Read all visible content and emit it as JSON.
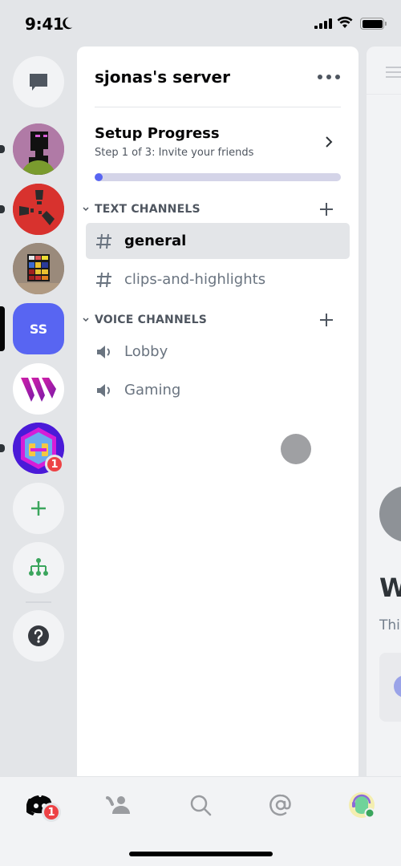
{
  "status_bar": {
    "time": "9:41",
    "focus_icon": "moon-icon",
    "signal_icon": "cellular-signal-icon",
    "wifi_icon": "wifi-icon",
    "battery_icon": "battery-icon"
  },
  "guild_sidebar": {
    "direct_messages": {
      "icon": "chat-bubble-icon",
      "label": "Direct Messages"
    },
    "servers": [
      {
        "name": "server-enderman",
        "icon": "enderman-avatar",
        "unread": true
      },
      {
        "name": "server-rust",
        "icon": "rust-logo-avatar",
        "unread": true
      },
      {
        "name": "server-rubiks",
        "icon": "rubiks-cube-avatar",
        "unread": false
      },
      {
        "name": "server-sjonas",
        "initials": "SS",
        "selected": true,
        "color": "#5865f2"
      },
      {
        "name": "server-w",
        "icon": "w-logo-avatar",
        "unread": false
      },
      {
        "name": "server-hex",
        "icon": "hexagon-logo-avatar",
        "unread": true,
        "mentions": "1"
      }
    ],
    "add_server": {
      "icon": "plus-icon",
      "color": "#3ba55d"
    },
    "explore": {
      "icon": "explore-hub-icon",
      "color": "#3ba55d"
    },
    "help": {
      "icon": "help-icon"
    }
  },
  "channel_panel": {
    "server_name": "sjonas's server",
    "more_icon": "ellipsis-icon",
    "setup": {
      "title": "Setup Progress",
      "subtitle": "Step 1 of 3: Invite your friends",
      "progress_percent": 2,
      "accent": "#5865f2"
    },
    "categories": [
      {
        "label": "TEXT CHANNELS",
        "channels": [
          {
            "name": "general",
            "type": "text",
            "active": true
          },
          {
            "name": "clips-and-highlights",
            "type": "text",
            "active": false
          }
        ]
      },
      {
        "label": "VOICE CHANNELS",
        "channels": [
          {
            "name": "Lobby",
            "type": "voice",
            "active": false
          },
          {
            "name": "Gaming",
            "type": "voice",
            "active": false
          }
        ]
      }
    ]
  },
  "peek_panel": {
    "heading_fragment": "W",
    "text_fragment": "Thi"
  },
  "tab_bar": {
    "tabs": [
      {
        "name": "home",
        "icon": "discord-logo-icon",
        "badge": "1",
        "active": true
      },
      {
        "name": "friends",
        "icon": "friends-icon",
        "active": false
      },
      {
        "name": "search",
        "icon": "search-icon",
        "active": false
      },
      {
        "name": "mentions",
        "icon": "at-sign-icon",
        "active": false
      },
      {
        "name": "profile",
        "icon": "user-avatar",
        "status": "online",
        "active": false
      }
    ]
  }
}
